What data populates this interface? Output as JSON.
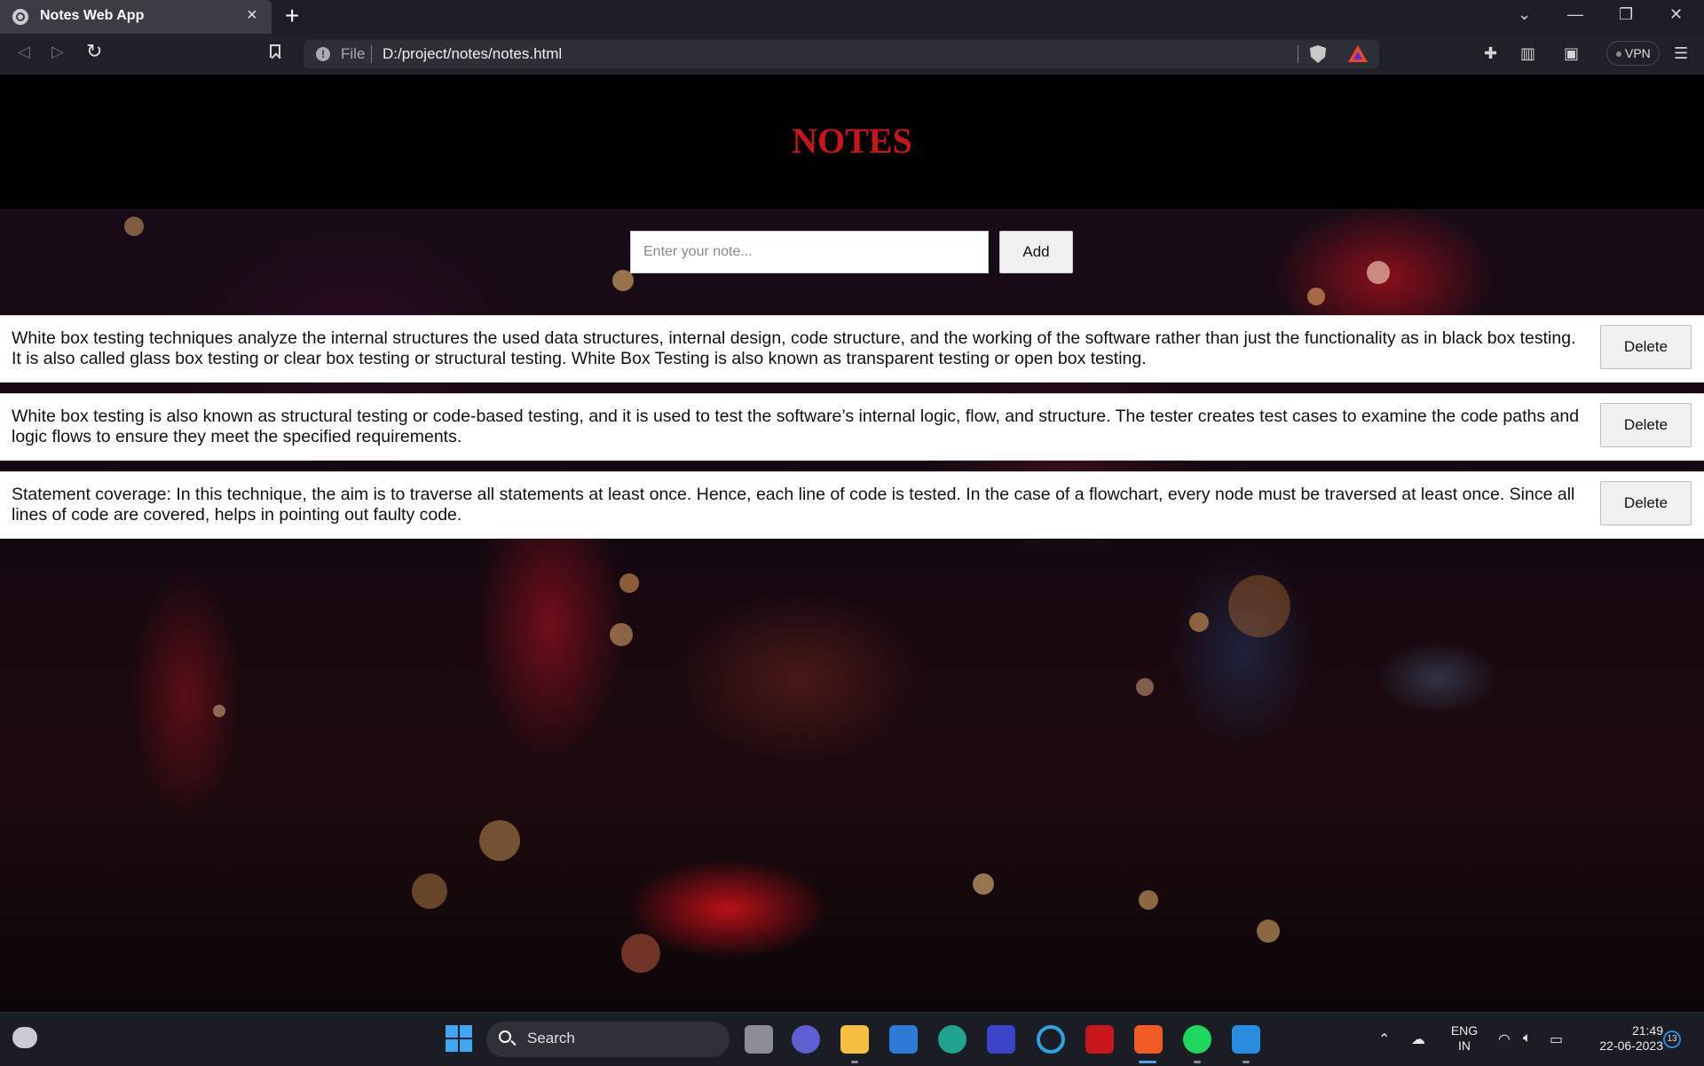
{
  "browser": {
    "tab_title": "Notes Web App",
    "tab_close": "×",
    "new_tab": "+",
    "window_controls": {
      "tab_search": "⌄",
      "minimize": "—",
      "restore": "❐",
      "close": "✕"
    },
    "address": {
      "scheme": "File",
      "url": "D:/project/notes/notes.html"
    },
    "vpn_label": "VPN"
  },
  "app": {
    "title": "NOTES",
    "input_placeholder": "Enter your note...",
    "add_label": "Add",
    "delete_label": "Delete",
    "title_color": "#c8151b",
    "notes": [
      "White box testing techniques analyze the internal structures the used data structures, internal design, code structure, and the working of the software rather than just the functionality as in black box testing. It is also called glass box testing or clear box testing or structural testing. White Box Testing is also known as transparent testing or open box testing.",
      "White box testing is also known as structural testing or code-based testing, and it is used to test the software’s internal logic, flow, and structure. The tester creates test cases to examine the code paths and logic flows to ensure they meet the specified requirements.",
      "Statement coverage: In this technique, the aim is to traverse all statements at least once. Hence, each line of code is tested. In the case of a flowchart, every node must be traversed at least once. Since all lines of code are covered, helps in pointing out faulty code."
    ]
  },
  "taskbar": {
    "search_label": "Search",
    "apps": [
      "task-view",
      "teams-chat",
      "file-explorer",
      "microsoft-store",
      "edge",
      "power-automate",
      "cortana",
      "mcafee",
      "brave",
      "spotify",
      "vscode"
    ],
    "language": {
      "line1": "ENG",
      "line2": "IN"
    },
    "clock": {
      "time": "21:49",
      "date": "22-06-2023"
    },
    "notification_count": "13"
  }
}
